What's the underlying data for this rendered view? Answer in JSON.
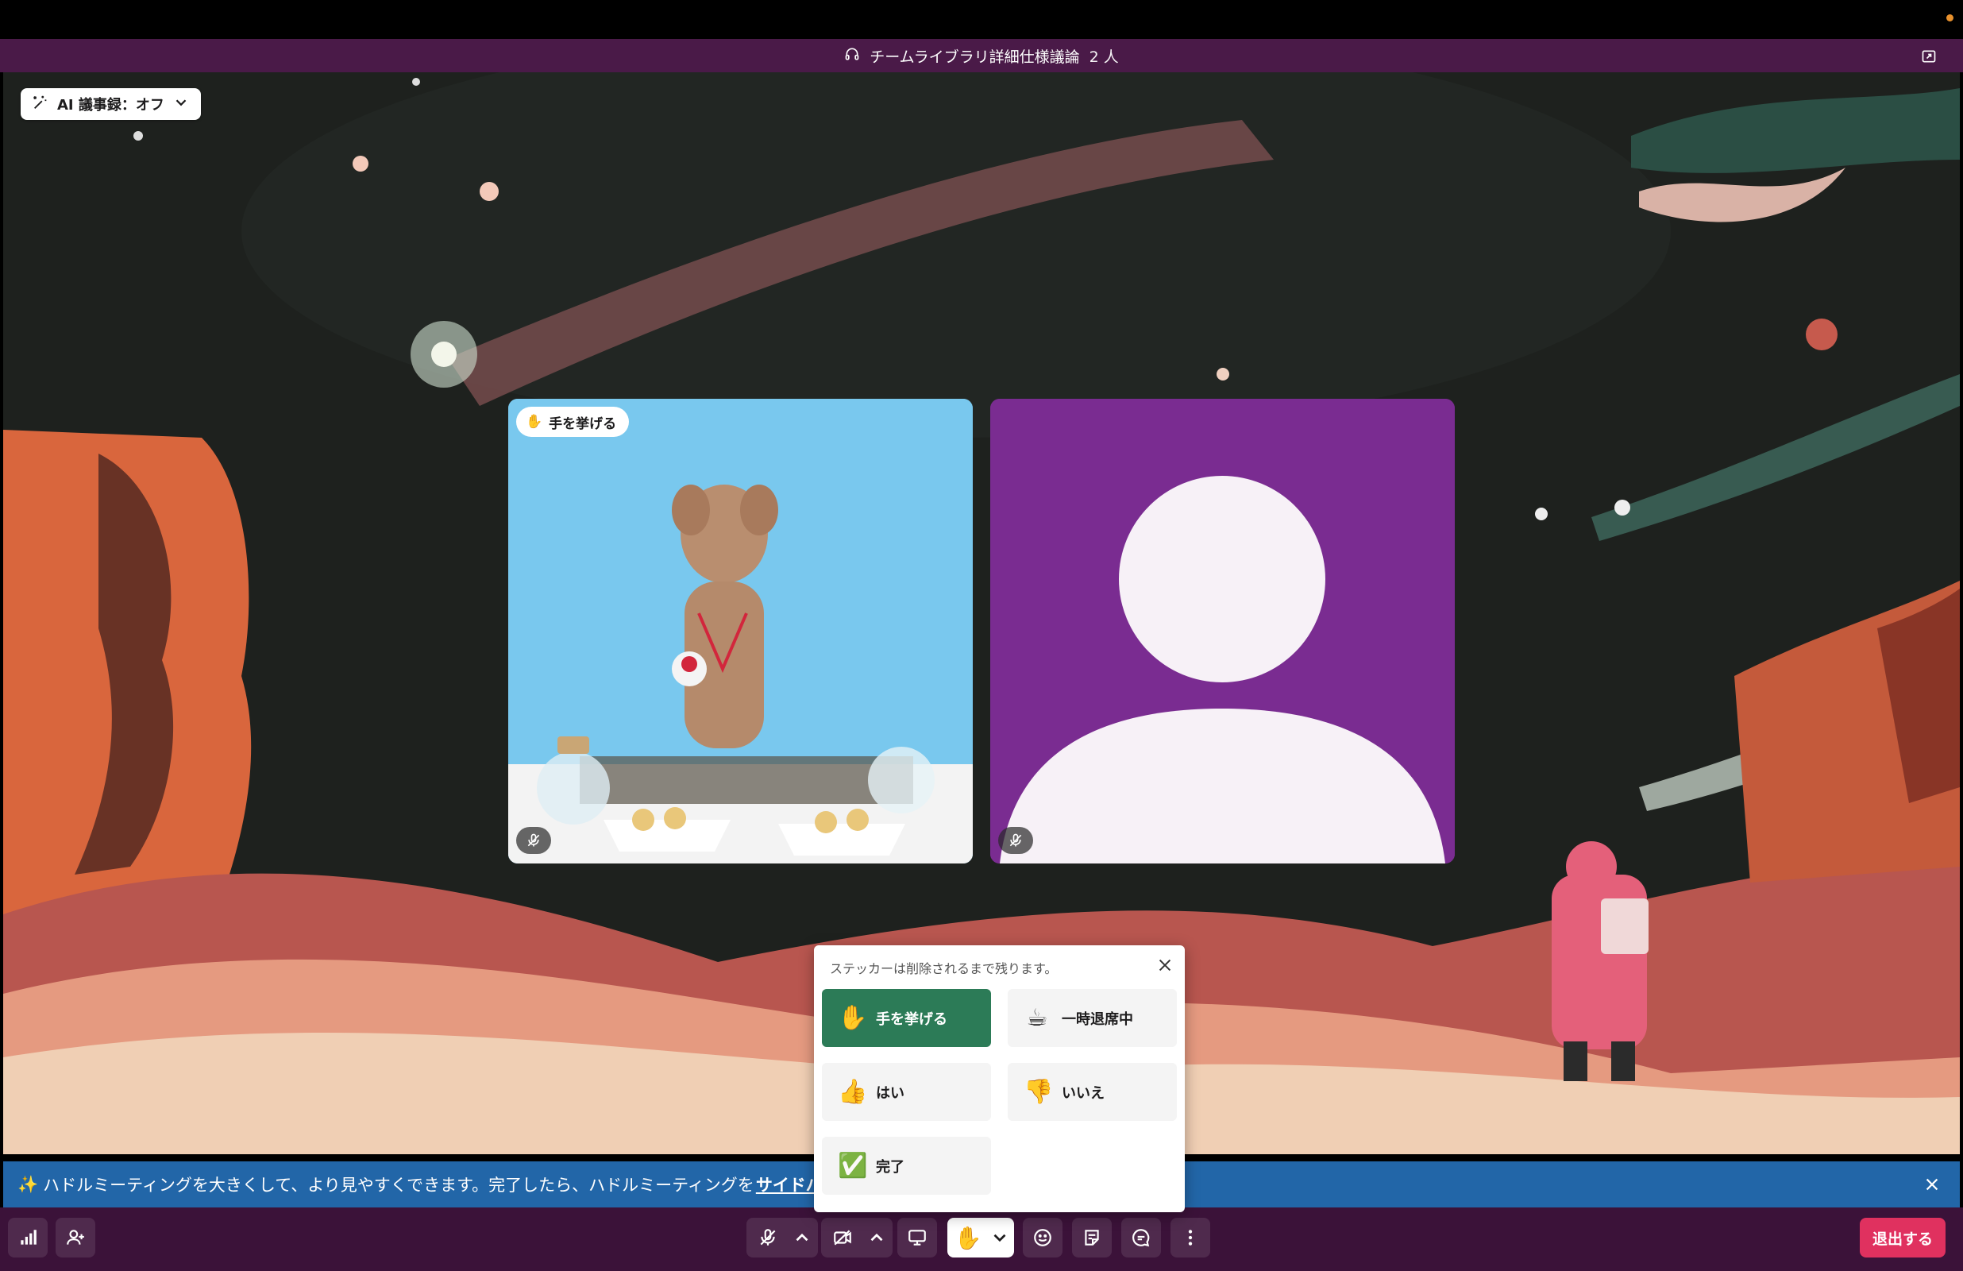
{
  "window": {
    "title": "チームライブラリ詳細仕様議論",
    "participant_count": "2 人"
  },
  "ai_notes": {
    "label": "AI 議事録：オフ"
  },
  "tiles": [
    {
      "badge": "手を挙げる",
      "badge_emoji": "✋",
      "muted": true
    },
    {
      "avatar": "default-avatar",
      "muted": true
    }
  ],
  "banner": {
    "sparkle": "✨",
    "text": "ハドルミーティングを大きくして、より見やすくできます。完了したら、ハドルミーティングを",
    "link": "サイドバーに戻せ"
  },
  "sticker_popover": {
    "hint": "ステッカーは削除されるまで残ります。",
    "items": [
      {
        "emoji": "✋",
        "label": "手を挙げる",
        "selected": true
      },
      {
        "emoji": "☕",
        "label": "一時退席中",
        "selected": false
      },
      {
        "emoji": "👍",
        "label": "はい",
        "selected": false
      },
      {
        "emoji": "👎",
        "label": "いいえ",
        "selected": false
      },
      {
        "emoji": "✅",
        "label": "完了",
        "selected": false
      }
    ]
  },
  "toolbar": {
    "raise_hand_emoji": "✋",
    "leave_label": "退出する"
  },
  "colors": {
    "titlebar": "#4a1a48",
    "toolbar": "#3b1239",
    "banner": "#2266a8",
    "leave": "#e0315f",
    "sticker_selected": "#2c7b57",
    "tile_avatar_bg": "#7a2c91"
  }
}
